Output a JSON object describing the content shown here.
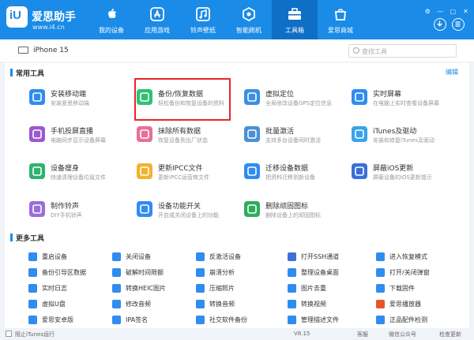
{
  "app": {
    "brand": "爱思助手",
    "url": "www.i4.cn",
    "logo": "iU"
  },
  "nav": [
    {
      "label": "我的设备",
      "icon": "apple-icon"
    },
    {
      "label": "应用游戏",
      "icon": "app-store-icon"
    },
    {
      "label": "铃声壁纸",
      "icon": "ringtone-icon"
    },
    {
      "label": "智能刷机",
      "icon": "flash-icon"
    },
    {
      "label": "工具箱",
      "icon": "toolbox-icon",
      "active": true
    },
    {
      "label": "爱思商城",
      "icon": "store-icon"
    }
  ],
  "window_controls": [
    "⚙",
    "—",
    "▢",
    "✕"
  ],
  "device": {
    "name": "iPhone 15"
  },
  "search": {
    "placeholder": "查找工具"
  },
  "common_tools": {
    "title": "常用工具",
    "edit": "编辑",
    "items": [
      {
        "title": "安装移动端",
        "sub": "安装爱思移动端",
        "color": "#2f8cf0"
      },
      {
        "title": "备份/恢复数据",
        "sub": "轻松备份和恢复设备的资料",
        "color": "#32c172"
      },
      {
        "title": "虚拟定位",
        "sub": "全局修改设备GPS定位信息",
        "color": "#3a8ee8"
      },
      {
        "title": "实时屏幕",
        "sub": "在电脑上实时查看设备屏幕",
        "color": "#2f8cf0"
      },
      {
        "title": "手机投屏直播",
        "sub": "电脑同步显示设备屏幕",
        "color": "#9b59d0"
      },
      {
        "title": "抹除所有数据",
        "sub": "恢复设备到出厂状态",
        "color": "#e96f9b"
      },
      {
        "title": "批量激活",
        "sub": "支持多台设备同时激活",
        "color": "#4a90d9"
      },
      {
        "title": "iTunes及驱动",
        "sub": "安装和修复iTunes及驱动",
        "color": "#3aa3ea"
      },
      {
        "title": "设备瘦身",
        "sub": "快速清理设备垃圾文件",
        "color": "#2db36f"
      },
      {
        "title": "更新IPCC文件",
        "sub": "更新IPCC运营商文件",
        "color": "#f3b22d"
      },
      {
        "title": "迁移设备数据",
        "sub": "把资料迁移到新设备",
        "color": "#2f8cf0"
      },
      {
        "title": "屏蔽iOS更新",
        "sub": "屏蔽设备的iOS更新提示",
        "color": "#3a6fd8"
      },
      {
        "title": "制作铃声",
        "sub": "DIY手机铃声",
        "color": "#9b6cdc"
      },
      {
        "title": "设备功能开关",
        "sub": "开启或关闭设备上的功能",
        "color": "#2f8cf0"
      },
      {
        "title": "删除顽固图标",
        "sub": "删除设备上的顽固图标",
        "color": "#2dae5d"
      }
    ]
  },
  "more_tools": {
    "title": "更多工具",
    "items": [
      {
        "label": "重启设备",
        "color": "#2f8cf0"
      },
      {
        "label": "关闭设备",
        "color": "#2f8cf0"
      },
      {
        "label": "反激活设备",
        "color": "#2f8cf0"
      },
      {
        "label": "打开SSH通道",
        "color": "#3d6fd6"
      },
      {
        "label": "进入恢复模式",
        "color": "#2f8cf0"
      },
      {
        "label": "备份引导区数据",
        "color": "#2f8cf0"
      },
      {
        "label": "破解时间限额",
        "color": "#2f8cf0"
      },
      {
        "label": "崩溃分析",
        "color": "#2f8cf0"
      },
      {
        "label": "整理设备桌面",
        "color": "#2f8cf0"
      },
      {
        "label": "打开/关闭弹窗",
        "color": "#2f8cf0"
      },
      {
        "label": "实时日志",
        "color": "#2f8cf0"
      },
      {
        "label": "转换HEIC图片",
        "color": "#2f8cf0"
      },
      {
        "label": "压缩照片",
        "color": "#2f8cf0"
      },
      {
        "label": "图片去重",
        "color": "#2f8cf0"
      },
      {
        "label": "下载固件",
        "color": "#2f8cf0"
      },
      {
        "label": "虚拟U盘",
        "color": "#2f8cf0"
      },
      {
        "label": "修改音频",
        "color": "#2f8cf0"
      },
      {
        "label": "转换音频",
        "color": "#2f8cf0"
      },
      {
        "label": "转换视频",
        "color": "#2f8cf0"
      },
      {
        "label": "爱思播放器",
        "color": "#e9542d"
      },
      {
        "label": "爱思安卓版",
        "color": "#2f8cf0"
      },
      {
        "label": "IPA签名",
        "color": "#2f8cf0"
      },
      {
        "label": "社交软件备份",
        "color": "#2f8cf0"
      },
      {
        "label": "管理描述文件",
        "color": "#2f8cf0"
      },
      {
        "label": "正品配件检测",
        "color": "#2f8cf0"
      }
    ]
  },
  "status": {
    "itunes_check": "阻止iTunes运行",
    "version": "V8.15",
    "feedback": "客服",
    "wechat": "微信公众号",
    "update": "检查更新"
  }
}
